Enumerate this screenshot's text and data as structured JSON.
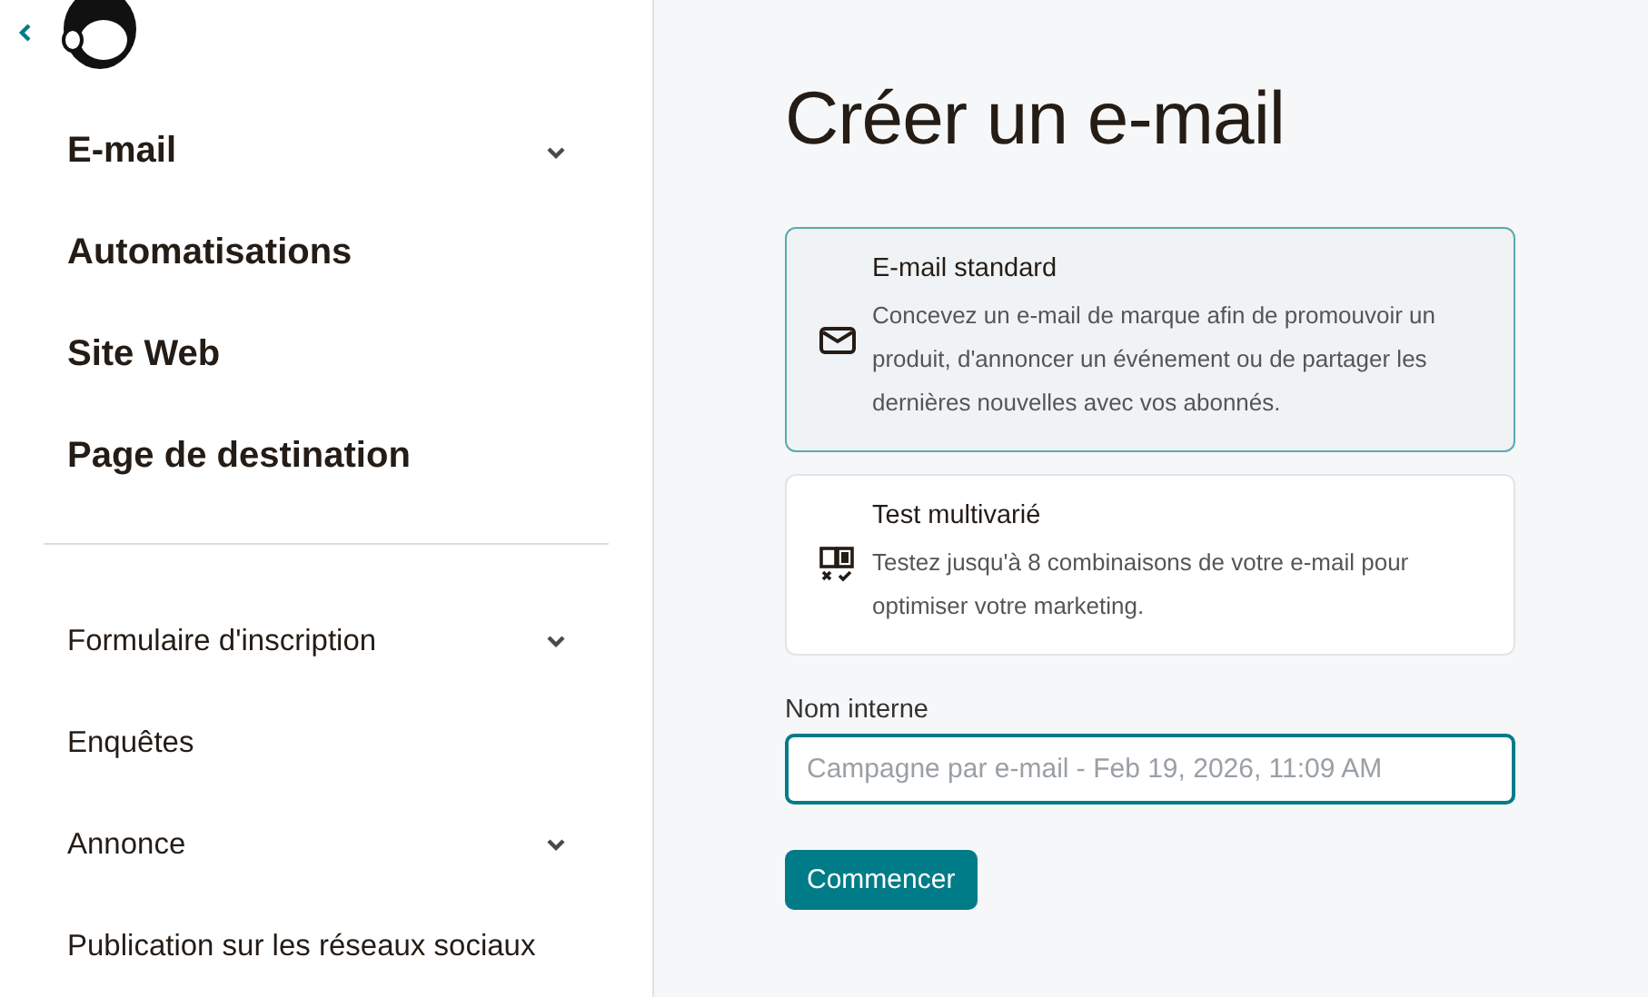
{
  "sidebar": {
    "items": [
      {
        "label": "E-mail",
        "kind": "primary",
        "expandable": true
      },
      {
        "label": "Automatisations",
        "kind": "primary",
        "expandable": false
      },
      {
        "label": "Site Web",
        "kind": "primary",
        "expandable": false
      },
      {
        "label": "Page de destination",
        "kind": "primary",
        "expandable": false
      },
      {
        "label": "Formulaire d'inscription",
        "kind": "secondary",
        "expandable": true
      },
      {
        "label": "Enquêtes",
        "kind": "secondary",
        "expandable": false
      },
      {
        "label": "Annonce",
        "kind": "secondary",
        "expandable": true
      },
      {
        "label": "Publication sur les réseaux sociaux",
        "kind": "secondary",
        "expandable": false
      }
    ]
  },
  "main": {
    "title": "Créer un e-mail",
    "options": [
      {
        "kind": "standard",
        "title": "E-mail standard",
        "description": "Concevez un e-mail de marque afin de promouvoir un produit, d'annoncer un événement ou de partager les dernières nouvelles avec vos abonnés.",
        "selected": true
      },
      {
        "kind": "multivariate",
        "title": "Test multivarié",
        "description": "Testez jusqu'à 8 combinaisons de votre e-mail pour optimiser votre marketing.",
        "selected": false
      }
    ],
    "name_field": {
      "label": "Nom interne",
      "placeholder": "Campagne par e-mail - Feb 19, 2026, 11:09 AM"
    },
    "submit": "Commencer"
  }
}
